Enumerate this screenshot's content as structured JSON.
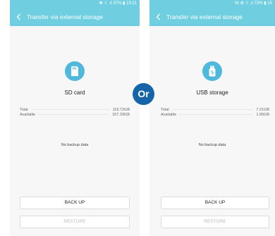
{
  "left_screen": {
    "status": "✖ ⇧ .ıl 37% ▮ 13:21",
    "title": "Transfer via external storage",
    "storage_label": "SD card",
    "total_label": "Total",
    "total_value": "119.72GB",
    "available_label": "Available",
    "available_value": "107.33GB",
    "empty_message": "No backup data",
    "backup_button": "BACK UP",
    "restore_button": "RESTORE"
  },
  "right_screen": {
    "status": "Nı ⚙ ⇧ .ıl 73% ▮ 15",
    "title": "Transfer via external storage",
    "storage_label": "USB storage",
    "total_label": "Total",
    "total_value": "7.21GB",
    "available_label": "Available",
    "available_value": "1.95GB",
    "empty_message": "No backup data",
    "backup_button": "BACK UP",
    "restore_button": "RESTORE"
  },
  "separator_label": "Or",
  "colors": {
    "app_bar": "#6fcfe0",
    "icon_circle": "#4fb9dd",
    "or_badge": "#1565a8"
  },
  "icons": {
    "back": "chevron-left-icon",
    "sd_card": "sd-card-icon",
    "usb": "usb-icon"
  }
}
